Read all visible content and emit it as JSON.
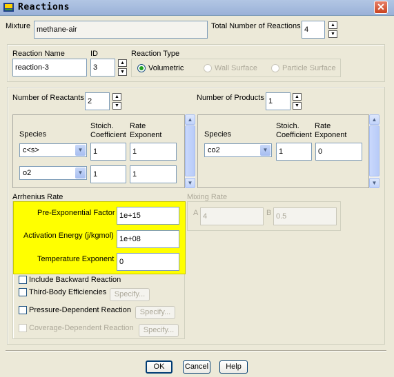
{
  "window": {
    "title": "Reactions",
    "close": "✕"
  },
  "mixture": {
    "label": "Mixture",
    "value": "methane-air"
  },
  "total_reactions": {
    "label": "Total Number of Reactions",
    "value": "4"
  },
  "reaction": {
    "name_label": "Reaction Name",
    "name_value": "reaction-3",
    "id_label": "ID",
    "id_value": "3",
    "type_label": "Reaction Type",
    "types": [
      "Volumetric",
      "Wall Surface",
      "Particle Surface"
    ],
    "selected_type": "Volumetric"
  },
  "reactants": {
    "count_label": "Number of Reactants",
    "count_value": "2",
    "col_species": "Species",
    "col_stoich": "Stoich. Coefficient",
    "col_rate": "Rate Exponent",
    "rows": [
      {
        "species": "c<s>",
        "stoich": "1",
        "rate": "1"
      },
      {
        "species": "o2",
        "stoich": "1",
        "rate": "1"
      }
    ]
  },
  "products": {
    "count_label": "Number of Products",
    "count_value": "1",
    "col_species": "Species",
    "col_stoich": "Stoich. Coefficient",
    "col_rate": "Rate Exponent",
    "rows": [
      {
        "species": "co2",
        "stoich": "1",
        "rate": "0"
      }
    ]
  },
  "arrhenius": {
    "label": "Arrhenius Rate",
    "pre_exp_label": "Pre-Exponential Factor",
    "pre_exp_value": "1e+15",
    "act_energy_label": "Activation Energy (j/kgmol)",
    "act_energy_value": "1e+08",
    "temp_exp_label": "Temperature Exponent",
    "temp_exp_value": "0"
  },
  "mixing": {
    "label": "Mixing Rate",
    "a_label": "A",
    "a_value": "4",
    "b_label": "B",
    "b_value": "0.5"
  },
  "options": {
    "backward": "Include Backward Reaction",
    "third_body": "Third-Body Efficiencies",
    "pressure": "Pressure-Dependent Reaction",
    "coverage": "Coverage-Dependent Reaction",
    "specify": "Specify..."
  },
  "buttons": {
    "ok": "OK",
    "cancel": "Cancel",
    "help": "Help"
  },
  "icons": {
    "up": "▲",
    "down": "▼"
  },
  "colors": {
    "highlight": "#ffff00",
    "title_bar": "#9ab1d8",
    "dialog_bg": "#ece9d8"
  }
}
